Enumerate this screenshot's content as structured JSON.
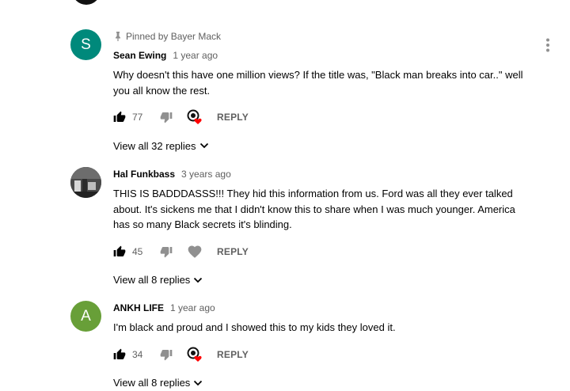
{
  "comments": [
    {
      "avatar_letter": "S",
      "avatar_color": "#00897b",
      "pinned_text": "Pinned by Bayer Mack",
      "author": "Sean Ewing",
      "time": "1 year ago",
      "text": "Why doesn't this have one million views? If the title was, \"Black man breaks into car..\" well you all know the rest.",
      "likes": "77",
      "reply_label": "REPLY",
      "replies_label": "View all 32 replies"
    },
    {
      "author": "Hal Funkbass",
      "time": "3 years ago",
      "text": "THIS IS BADDDASSS!!! They hid this information from us. Ford was all they ever talked about. It's sickens me that I didn't know this to share when I was much younger. America has so many Black secrets it's blinding.",
      "likes": "45",
      "reply_label": "REPLY",
      "replies_label": "View all 8 replies"
    },
    {
      "avatar_letter": "A",
      "avatar_color": "#689f38",
      "author": "ANKH LIFE",
      "time": "1 year ago",
      "text": "I'm black and proud and I showed this to my kids they loved it.",
      "likes": "34",
      "reply_label": "REPLY",
      "replies_label": "View all 8 replies"
    }
  ],
  "icons": {
    "like": "thumbs-up-icon",
    "dislike": "thumbs-down-icon",
    "creator_heart": "creator-heart-icon",
    "heart": "heart-icon",
    "chevron": "chevron-down-icon",
    "menu": "more-vert-icon",
    "pin": "pin-icon"
  }
}
